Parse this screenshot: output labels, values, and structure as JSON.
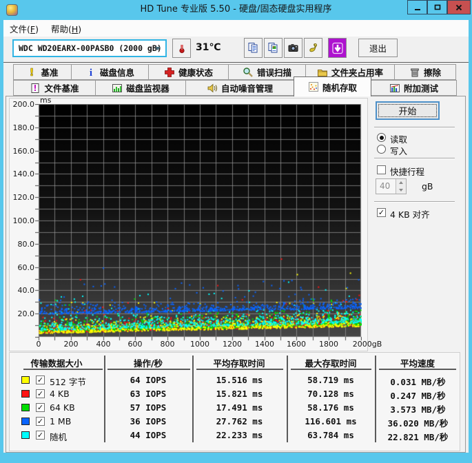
{
  "window": {
    "title": "HD Tune 专业版 5.50 - 硬盘/固态硬盘实用程序"
  },
  "menu": {
    "items": [
      {
        "pre": "文件(",
        "key": "F",
        "post": ")"
      },
      {
        "pre": "帮助(",
        "key": "H",
        "post": ")"
      }
    ]
  },
  "toolbar": {
    "drive": "WDC WD20EARX-00PASB0 (2000 gB)",
    "temperature": "31℃",
    "exit_label": "退出"
  },
  "tabs": {
    "row1": [
      {
        "label": "基准"
      },
      {
        "label": "磁盘信息"
      },
      {
        "label": "健康状态"
      },
      {
        "label": "错误扫描"
      },
      {
        "label": "文件夹占用率"
      },
      {
        "label": "擦除"
      }
    ],
    "row2": [
      {
        "label": "文件基准"
      },
      {
        "label": "磁盘监视器"
      },
      {
        "label": "自动噪音管理"
      },
      {
        "label": "随机存取",
        "selected": true
      },
      {
        "label": "附加测试"
      }
    ]
  },
  "controls": {
    "start_label": "开始",
    "read_label": "读取",
    "read_checked": true,
    "write_label": "写入",
    "write_checked": false,
    "short_stroke_label": "快捷行程",
    "short_stroke_checked": false,
    "short_stroke_value": "40",
    "short_stroke_unit": "gB",
    "align_label": "4 KB 对齐",
    "align_checked": true,
    "check_glyph": "✓"
  },
  "chart": {
    "y_unit": "ms"
  },
  "chart_data": {
    "type": "scatter",
    "xlabel": "gB",
    "ylabel": "ms",
    "xlim": [
      0,
      2000
    ],
    "ylim": [
      0,
      200
    ],
    "x_tick_labels": [
      "0",
      "200",
      "400",
      "600",
      "800",
      "1000",
      "1200",
      "1400",
      "1600",
      "1800",
      "2000gB"
    ],
    "y_tick_labels": [
      "200.0",
      "180.0",
      "160.0",
      "140.0",
      "120.0",
      "100.0",
      "80.0",
      "60.0",
      "40.0",
      "20.0"
    ],
    "grid": {
      "x_minor_step_gb": 100,
      "y_minor_step_ms": 10,
      "background": "gradient #000000 to #474747"
    },
    "legend_position": "bottom-table",
    "draw_order": [
      1,
      2,
      0,
      4,
      3
    ],
    "series": [
      {
        "name": "512 字节",
        "color": "#ffff00",
        "iops": 64,
        "avg_ms": 15.516,
        "max_ms": 58.719,
        "speed_mb_s": 0.031,
        "render": {
          "seed": 11,
          "count": 850,
          "floor_start": 3.5,
          "floor_end": 9.5,
          "scale": 7,
          "out_rate": 0.03,
          "out_extra": 22,
          "rare_rate": 0.004,
          "rare_extra": 46
        }
      },
      {
        "name": "4 KB",
        "color": "#ff1212",
        "iops": 63,
        "avg_ms": 15.821,
        "max_ms": 70.128,
        "speed_mb_s": 0.247,
        "render": {
          "seed": 22,
          "count": 850,
          "floor_start": 4.0,
          "floor_end": 10.0,
          "scale": 7,
          "out_rate": 0.03,
          "out_extra": 22,
          "rare_rate": 0.004,
          "rare_extra": 58
        }
      },
      {
        "name": "64 KB",
        "color": "#00dd00",
        "iops": 57,
        "avg_ms": 17.491,
        "max_ms": 58.176,
        "speed_mb_s": 3.573,
        "render": {
          "seed": 33,
          "count": 850,
          "floor_start": 4.5,
          "floor_end": 10.5,
          "scale": 8,
          "out_rate": 0.03,
          "out_extra": 22,
          "rare_rate": 0.004,
          "rare_extra": 45
        }
      },
      {
        "name": "1 MB",
        "color": "#0a64ff",
        "iops": 36,
        "avg_ms": 27.762,
        "max_ms": 116.601,
        "speed_mb_s": 36.02,
        "render": {
          "seed": 44,
          "count": 750,
          "floor_start": 20,
          "floor_end": 25,
          "scale": 5,
          "out_rate": 0.07,
          "out_extra": 22,
          "rare_rate": 0.004,
          "rare_extra": 86
        }
      },
      {
        "name": "随机",
        "color": "#00ffff",
        "iops": 44,
        "avg_ms": 22.233,
        "max_ms": 63.784,
        "speed_mb_s": 22.821,
        "render": {
          "seed": 55,
          "count": 750,
          "floor_start": 6,
          "floor_end": 12.5,
          "scale": 9,
          "out_rate": 0.05,
          "out_extra": 24,
          "rare_rate": 0.004,
          "rare_extra": 48
        }
      }
    ]
  },
  "table": {
    "headers": [
      "传输数据大小",
      "操作/秒",
      "平均存取时间",
      "最大存取时间",
      "平均速度"
    ],
    "rows": [
      {
        "color": "#ffff00",
        "label": "512 字节",
        "checked": true,
        "iops": "64 IOPS",
        "avg": "15.516 ms",
        "max": "58.719 ms",
        "speed": "0.031 MB/秒"
      },
      {
        "color": "#ff1212",
        "label": "4 KB",
        "checked": true,
        "iops": "63 IOPS",
        "avg": "15.821 ms",
        "max": "70.128 ms",
        "speed": "0.247 MB/秒"
      },
      {
        "color": "#00dd00",
        "label": "64 KB",
        "checked": true,
        "iops": "57 IOPS",
        "avg": "17.491 ms",
        "max": "58.176 ms",
        "speed": "3.573 MB/秒"
      },
      {
        "color": "#0a64ff",
        "label": "1 MB",
        "checked": true,
        "iops": "36 IOPS",
        "avg": "27.762 ms",
        "max": "116.601 ms",
        "speed": "36.020 MB/秒"
      },
      {
        "color": "#00ffff",
        "label": "随机",
        "checked": true,
        "iops": "44 IOPS",
        "avg": "22.233 ms",
        "max": "63.784 ms",
        "speed": "22.821 MB/秒"
      }
    ]
  }
}
